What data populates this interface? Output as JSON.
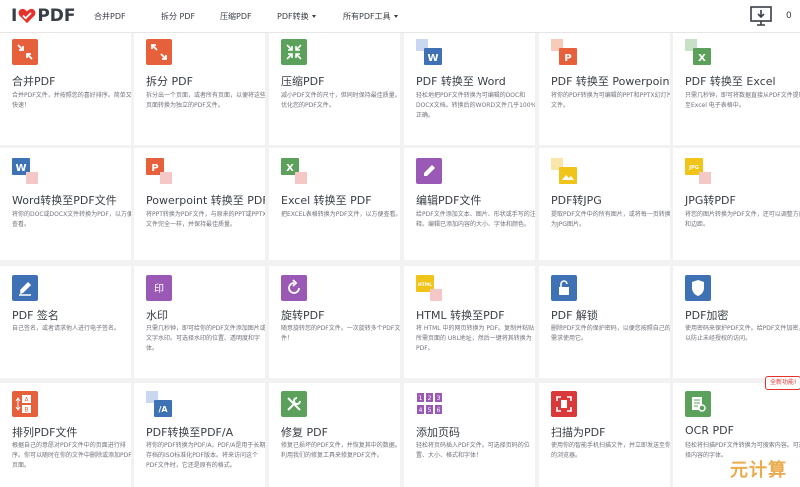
{
  "header": {
    "logo_i": "I",
    "logo_pdf": "PDF",
    "nav": [
      {
        "label": "合并PDF",
        "dropdown": false
      },
      {
        "label": "拆分 PDF",
        "dropdown": false
      },
      {
        "label": "压缩PDF",
        "dropdown": false
      },
      {
        "label": "PDF转换",
        "dropdown": true
      },
      {
        "label": "所有PDF工具",
        "dropdown": true
      }
    ],
    "right_label": "0"
  },
  "colors": {
    "orange": "#e5603b",
    "red": "#e5322d",
    "green": "#5ba05b",
    "blue": "#3f72b5",
    "purple": "#9b59b6",
    "pdf_red": "#d93939",
    "yellow": "#f0c419"
  },
  "tools": [
    {
      "title": "合并PDF",
      "desc": "合并PDF文件，并按照您的喜好排序。简单又快速！",
      "icon": "merge-icon"
    },
    {
      "title": "拆分 PDF",
      "desc": "拆分出一个页面，或者所有页面，以便将这些页面转换为独立的PDF文件。",
      "icon": "split-icon"
    },
    {
      "title": "压缩PDF",
      "desc": "减小PDF文件的尺寸，但同时保持最佳质量。优化您的PDF文件。",
      "icon": "compress-icon"
    },
    {
      "title": "PDF 转换至 Word",
      "desc": "轻松地把PDF文件转换为可编辑的DOC和DOCX文档。转换后的WORD文件几乎100%正确。",
      "icon": "pdf-to-word-icon"
    },
    {
      "title": "PDF 转换至 Powerpoint",
      "desc": "将你的PDF转换为可编辑的PPT和PPTX幻灯片文件。",
      "icon": "pdf-to-powerpoint-icon"
    },
    {
      "title": "PDF 转换至 Excel",
      "desc": "只需几秒钟，即可将数据直接从PDF文件提取至Excel 电子表格中。",
      "icon": "pdf-to-excel-icon"
    },
    {
      "title": "Word转换至PDF文件",
      "desc": "将你的DOC或DOCX文件转换为PDF，以方便查看。",
      "icon": "word-to-pdf-icon"
    },
    {
      "title": "Powerpoint 转换至 PDF",
      "desc": "将PPT转换为PDF文件，与原来的PPT或PPTX文件完全一样，并保持最佳质量。",
      "icon": "powerpoint-to-pdf-icon"
    },
    {
      "title": "Excel 转换至 PDF",
      "desc": "把EXCEL表格转换为PDF文件，以方便查看。",
      "icon": "excel-to-pdf-icon"
    },
    {
      "title": "编辑PDF文件",
      "desc": "给PDF文件添加文本、图片、形状或手写的注释。编辑已添加内容的大小、字体和颜色。",
      "icon": "edit-pdf-icon"
    },
    {
      "title": "PDF转JPG",
      "desc": "提取PDF文件中的所有图片，或将每一页转换为JPG图片。",
      "icon": "pdf-to-jpg-icon"
    },
    {
      "title": "JPG转PDF",
      "desc": "将您的图片转换为PDF文件，还可以调整方向和边距。",
      "icon": "jpg-to-pdf-icon"
    },
    {
      "title": "PDF 签名",
      "desc": "自己签名，或者请求他人进行电子签名。",
      "icon": "sign-pdf-icon"
    },
    {
      "title": "水印",
      "desc": "只需几秒钟，即可给你的PDF文件添加图片或文字水印。可选择水印的位置、透明度和字体。",
      "icon": "watermark-icon"
    },
    {
      "title": "旋转PDF",
      "desc": "随意旋转您的PDF文件。一次旋转多个PDF文件！",
      "icon": "rotate-pdf-icon"
    },
    {
      "title": "HTML 转换至PDF",
      "desc": "将 HTML 中的网页转换为 PDF。复制并粘贴所需页面的 URL地址，然后一键将其转换为 PDF。",
      "icon": "html-to-pdf-icon"
    },
    {
      "title": "PDF 解锁",
      "desc": "删除PDF文件的保护密码，以便您按照自己的需求使用它。",
      "icon": "unlock-pdf-icon"
    },
    {
      "title": "PDF加密",
      "desc": "使用密码来保护PDF文件。给PDF文件加密，以防止未经授权的访问。",
      "icon": "protect-pdf-icon"
    },
    {
      "title": "排列PDF文件",
      "desc": "根据自己的意愿对PDF文件中的页面进行排序。你可以随时在你的文件中删除或添加PDF页面。",
      "icon": "organize-pdf-icon"
    },
    {
      "title": "PDF转换至PDF/A",
      "desc": "将你的PDF转换为PDF/A。PDF/A是用于长期存档的ISO标准化PDF版本。将来访问这个PDF文件时，它还是原有的格式。",
      "icon": "pdf-to-pdfa-icon"
    },
    {
      "title": "修复 PDF",
      "desc": "修复已损坏的PDF文件，并恢复其中的数据。利用我们的修复工具来修复PDF文件。",
      "icon": "repair-pdf-icon"
    },
    {
      "title": "添加页码",
      "desc": "轻松将页码插入PDF文件。可选择页码的位置、大小、格式和字体！",
      "icon": "page-numbers-icon"
    },
    {
      "title": "扫描为PDF",
      "desc": "使用你的智能手机扫描文件，并立即发送至你的浏览器。",
      "icon": "scan-to-pdf-icon"
    },
    {
      "title": "OCR PDF",
      "desc": "轻松将扫描PDF文件转换为可搜索内容。可选择内容的字体。",
      "icon": "ocr-pdf-icon"
    }
  ],
  "icon_text": {
    "word": "W",
    "powerpoint": "P",
    "excel": "X",
    "jpg": "JPG",
    "html": "HTML",
    "pdfa": "/A",
    "organize_a": "A",
    "organize_b": "B",
    "numbers": [
      "1",
      "2",
      "3",
      "4",
      "5",
      "6"
    ],
    "watermark": "印"
  },
  "badge": "全新功能!",
  "watermark": "元计算"
}
